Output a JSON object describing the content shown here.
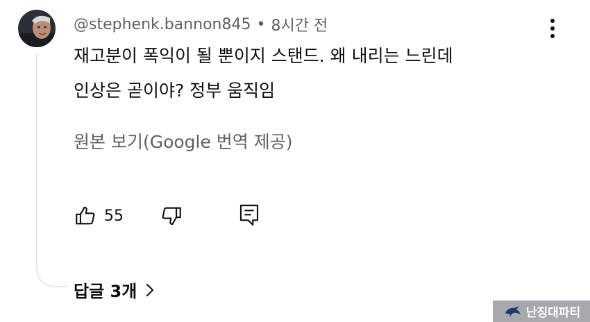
{
  "comment": {
    "author": "@stephenk.bannon845",
    "separator": "•",
    "time_ago": "8시간 전",
    "text_lines": [
      "재고분이 폭익이 될 뿐이지 스탠드. 왜 내리는 느린데",
      "인상은 곧이야? 정부 움직임"
    ],
    "translate_link": "원본 보기(Google 번역 제공)",
    "like_count": "55",
    "replies_label": "답글 3개"
  },
  "icons": {
    "more": "kebab-menu-icon",
    "like": "thumbs-up-icon",
    "dislike": "thumbs-down-icon",
    "reply": "comment-reply-icon",
    "expand": "chevron-right-icon"
  },
  "watermark": {
    "text": "난징대파티"
  },
  "colors": {
    "primary_text": "#0f0f0f",
    "secondary_text": "#606060",
    "thread_line": "#e5e5e5",
    "watermark_bg": "#a7a9ad"
  }
}
